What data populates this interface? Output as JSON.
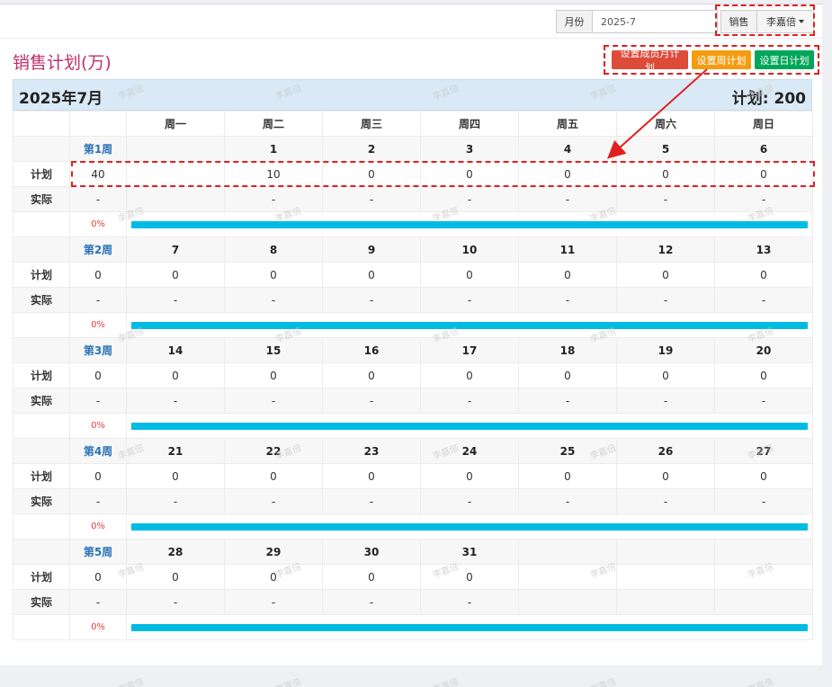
{
  "topbar": {
    "month_label": "月份",
    "month_value": "2025-7",
    "sales_label": "销售",
    "person": "李嘉倍"
  },
  "page_title": "销售计划(万)",
  "buttons": {
    "member_month": "设置成员月计划",
    "week": "设置周计划",
    "day": "设置日计划"
  },
  "calendar": {
    "month_title": "2025年7月",
    "total": "计划: 200",
    "weekdays": [
      "周一",
      "周二",
      "周三",
      "周四",
      "周五",
      "周六",
      "周日"
    ],
    "plan_label": "计划",
    "actual_label": "实际",
    "weeks": [
      {
        "label": "第1周",
        "days": [
          "",
          "1",
          "2",
          "3",
          "4",
          "5",
          "6"
        ],
        "week_plan": "40",
        "plan": [
          "",
          "10",
          "0",
          "0",
          "0",
          "0",
          "0"
        ],
        "week_actual": "-",
        "actual": [
          "",
          "-",
          "-",
          "-",
          "-",
          "-",
          "-"
        ],
        "pct": "0%",
        "progress": 0
      },
      {
        "label": "第2周",
        "days": [
          "7",
          "8",
          "9",
          "10",
          "11",
          "12",
          "13"
        ],
        "week_plan": "0",
        "plan": [
          "0",
          "0",
          "0",
          "0",
          "0",
          "0",
          "0"
        ],
        "week_actual": "-",
        "actual": [
          "-",
          "-",
          "-",
          "-",
          "-",
          "-",
          "-"
        ],
        "pct": "0%",
        "progress": 0
      },
      {
        "label": "第3周",
        "days": [
          "14",
          "15",
          "16",
          "17",
          "18",
          "19",
          "20"
        ],
        "week_plan": "0",
        "plan": [
          "0",
          "0",
          "0",
          "0",
          "0",
          "0",
          "0"
        ],
        "week_actual": "-",
        "actual": [
          "-",
          "-",
          "-",
          "-",
          "-",
          "-",
          "-"
        ],
        "pct": "0%",
        "progress": 0
      },
      {
        "label": "第4周",
        "days": [
          "21",
          "22",
          "23",
          "24",
          "25",
          "26",
          "27"
        ],
        "week_plan": "0",
        "plan": [
          "0",
          "0",
          "0",
          "0",
          "0",
          "0",
          "0"
        ],
        "week_actual": "-",
        "actual": [
          "-",
          "-",
          "-",
          "-",
          "-",
          "-",
          "-"
        ],
        "pct": "0%",
        "progress": 0
      },
      {
        "label": "第5周",
        "days": [
          "28",
          "29",
          "30",
          "31",
          "",
          "",
          ""
        ],
        "week_plan": "0",
        "plan": [
          "0",
          "0",
          "0",
          "0",
          "",
          "",
          ""
        ],
        "week_actual": "-",
        "actual": [
          "-",
          "-",
          "-",
          "-",
          "",
          "",
          ""
        ],
        "pct": "0%",
        "progress": 0
      }
    ]
  },
  "watermark": "李嘉倍",
  "colors": {
    "title": "#c0306c",
    "header_bg": "#d9eaf6",
    "bar": "#00bce3",
    "annotation": "#e02020"
  }
}
